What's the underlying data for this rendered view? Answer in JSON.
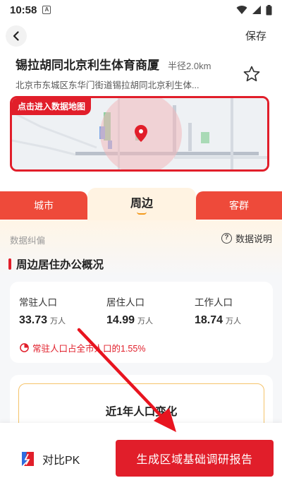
{
  "status_bar": {
    "time": "10:58",
    "notification_badge": "A"
  },
  "header": {
    "save_label": "保存"
  },
  "place": {
    "title": "锡拉胡同北京利生体育商厦",
    "radius": "半径2.0km",
    "address": "北京市东城区东华门街道锡拉胡同北京利生体..."
  },
  "map": {
    "enter_label": "点击进入数据地图"
  },
  "tabs": [
    {
      "label": "城市",
      "active": false
    },
    {
      "label": "周边",
      "active": true
    },
    {
      "label": "客群",
      "active": false
    }
  ],
  "content": {
    "data_correction": "数据纠偏",
    "data_explain": "数据说明",
    "section_title": "周边居住办公概况",
    "stats": [
      {
        "label": "常驻人口",
        "value": "33.73",
        "unit": "万人"
      },
      {
        "label": "居住人口",
        "value": "14.99",
        "unit": "万人"
      },
      {
        "label": "工作人口",
        "value": "18.74",
        "unit": "万人"
      }
    ],
    "ratio_text": "常驻人口占全市人口的1.55%",
    "change_title": "近1年人口变化"
  },
  "bottom": {
    "compare_label": "对比PK",
    "report_label": "生成区域基础调研报告"
  },
  "colors": {
    "accent": "#e11e2a",
    "tab_bg": "#ee4a3a",
    "highlight": "#f39a1c"
  }
}
